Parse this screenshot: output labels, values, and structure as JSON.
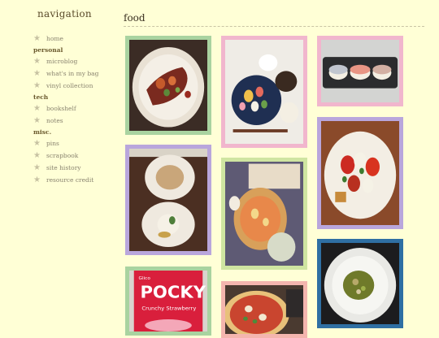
{
  "navigation": {
    "title": "navigation",
    "items": [
      {
        "type": "link",
        "label": "home"
      },
      {
        "type": "section",
        "label": "personal"
      },
      {
        "type": "link",
        "label": "microblog"
      },
      {
        "type": "link",
        "label": "what's in my bag"
      },
      {
        "type": "link",
        "label": "vinyl collection"
      },
      {
        "type": "section",
        "label": "tech"
      },
      {
        "type": "link",
        "label": "bookshelf"
      },
      {
        "type": "link",
        "label": "notes"
      },
      {
        "type": "section",
        "label": "misc."
      },
      {
        "type": "link",
        "label": "pins"
      },
      {
        "type": "link",
        "label": "scrapbook"
      },
      {
        "type": "link",
        "label": "site history"
      },
      {
        "type": "link",
        "label": "resource credit"
      }
    ]
  },
  "page": {
    "title": "food"
  },
  "photos": [
    {
      "name": "photo-steak-plate",
      "frame": "green",
      "scene": "steak"
    },
    {
      "name": "photo-sushi-platter",
      "frame": "pink",
      "scene": "sushi-platter"
    },
    {
      "name": "photo-nigiri",
      "frame": "pink",
      "scene": "nigiri"
    },
    {
      "name": "photo-tomato-caprese",
      "frame": "lavender",
      "scene": "caprese"
    },
    {
      "name": "photo-two-plates",
      "frame": "lavender",
      "scene": "two-plates"
    },
    {
      "name": "photo-pizza-bread",
      "frame": "lime",
      "scene": "pizza-bread"
    },
    {
      "name": "photo-pocky-box",
      "frame": "green",
      "scene": "pocky",
      "text": {
        "brand": "Glico",
        "product": "POCKY",
        "flavor": "Crunchy Strawberry"
      }
    },
    {
      "name": "photo-pizza",
      "frame": "salmon",
      "scene": "pizza"
    },
    {
      "name": "photo-green-soup",
      "frame": "blue",
      "scene": "soup"
    }
  ],
  "colors": {
    "background": "#ffffd6",
    "frame_green": "#a9d3a0",
    "frame_pink": "#f1b6cd",
    "frame_lavender": "#b9a6dc",
    "frame_lime": "#cfe5a1",
    "frame_salmon": "#f4b5ae",
    "frame_blue": "#2f6fa3"
  }
}
